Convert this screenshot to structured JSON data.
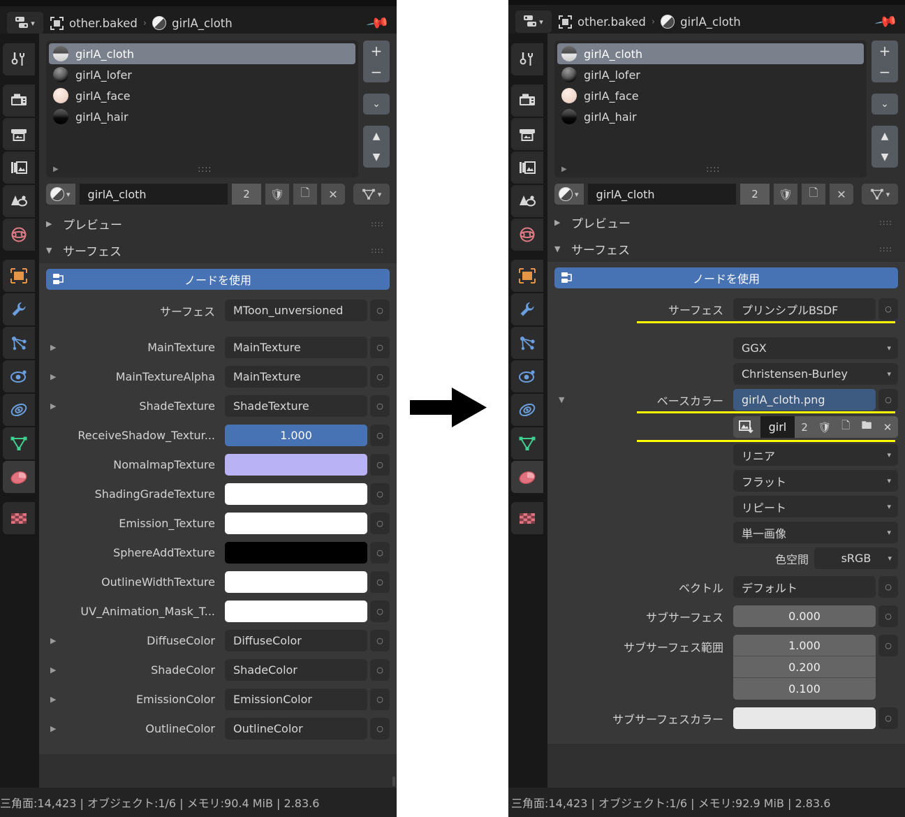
{
  "window": {
    "breadcrumb": {
      "object": "other.baked",
      "separator": "›",
      "material": "girlA_cloth"
    },
    "editor_type_icon": "properties-editor-icon",
    "pin_icon": "pin-icon"
  },
  "tabs": [
    {
      "name": "tool",
      "icon": "tool-icon"
    },
    {
      "name": "render",
      "icon": "camera-back-icon"
    },
    {
      "name": "output",
      "icon": "printer-icon"
    },
    {
      "name": "view-layer",
      "icon": "images-icon"
    },
    {
      "name": "scene",
      "icon": "scene-cone-icon"
    },
    {
      "name": "world",
      "icon": "world-globe-icon"
    },
    {
      "name": "object",
      "icon": "object-square-icon"
    },
    {
      "name": "modifiers",
      "icon": "wrench-icon"
    },
    {
      "name": "particles",
      "icon": "particles-icon"
    },
    {
      "name": "physics",
      "icon": "physics-orbit-icon"
    },
    {
      "name": "constraints",
      "icon": "constraint-icon"
    },
    {
      "name": "object-data",
      "icon": "mesh-data-icon"
    },
    {
      "name": "material",
      "icon": "material-sphere-icon"
    },
    {
      "name": "texture",
      "icon": "checker-texture-icon"
    }
  ],
  "material_slots": {
    "items": [
      {
        "label": "girlA_cloth",
        "thumb": "th-cloth",
        "selected": true
      },
      {
        "label": "girlA_lofer",
        "thumb": "th-lofer",
        "selected": false
      },
      {
        "label": "girlA_face",
        "thumb": "th-face",
        "selected": false
      },
      {
        "label": "girlA_hair",
        "thumb": "th-hair",
        "selected": false
      }
    ],
    "buttons": {
      "add": "+",
      "remove": "−",
      "menu": "⌄",
      "move_up": "▲",
      "move_down": "▼"
    }
  },
  "material_id": {
    "browse_icon": "material-browse-icon",
    "name": "girlA_cloth",
    "users": "2",
    "fake_user_icon": "shield-icon",
    "copy_icon": "copy-icon",
    "unlink_icon": "x-icon",
    "slot_link_icon": "mesh-data-icon"
  },
  "panels": {
    "preview": {
      "label": "プレビュー",
      "open": false
    },
    "surface": {
      "label": "サーフェス",
      "open": true
    }
  },
  "use_nodes_label": "ノードを使用",
  "left_panel": {
    "status": "三角面:14,423 | オブジェクト:1/6 | メモリ:90.4 MiB | 2.83.6",
    "rows": [
      {
        "expand": false,
        "label": "サーフェス",
        "value": "MToon_unversioned",
        "kind": "text",
        "gap": true
      },
      {
        "expand": true,
        "label": "MainTexture",
        "value": "MainTexture",
        "kind": "text"
      },
      {
        "expand": true,
        "label": "MainTextureAlpha",
        "value": "MainTexture",
        "kind": "text"
      },
      {
        "expand": true,
        "label": "ShadeTexture",
        "value": "ShadeTexture",
        "kind": "text"
      },
      {
        "expand": false,
        "label": "ReceiveShadow_Textur...",
        "value": "1.000",
        "kind": "slider"
      },
      {
        "expand": false,
        "label": "NomalmapTexture",
        "value": "",
        "kind": "swatch",
        "swatch": "sw-lav"
      },
      {
        "expand": false,
        "label": "ShadingGradeTexture",
        "value": "",
        "kind": "swatch",
        "swatch": "sw-white"
      },
      {
        "expand": false,
        "label": "Emission_Texture",
        "value": "",
        "kind": "swatch",
        "swatch": "sw-white"
      },
      {
        "expand": false,
        "label": "SphereAddTexture",
        "value": "",
        "kind": "swatch",
        "swatch": "sw-black"
      },
      {
        "expand": false,
        "label": "OutlineWidthTexture",
        "value": "",
        "kind": "swatch",
        "swatch": "sw-white"
      },
      {
        "expand": false,
        "label": "UV_Animation_Mask_T...",
        "value": "",
        "kind": "swatch",
        "swatch": "sw-white"
      },
      {
        "expand": true,
        "label": "DiffuseColor",
        "value": "DiffuseColor",
        "kind": "text"
      },
      {
        "expand": true,
        "label": "ShadeColor",
        "value": "ShadeColor",
        "kind": "text"
      },
      {
        "expand": true,
        "label": "EmissionColor",
        "value": "EmissionColor",
        "kind": "text"
      },
      {
        "expand": true,
        "label": "OutlineColor",
        "value": "OutlineColor",
        "kind": "text"
      }
    ]
  },
  "right_panel": {
    "status": "三角面:14,423 | オブジェクト:1/6 | メモリ:92.9 MiB | 2.83.6",
    "surface_label": "サーフェス",
    "surface_value": "プリンシプルBSDF",
    "distribution": "GGX",
    "subsurface_method": "Christensen-Burley",
    "base_color_label": "ベースカラー",
    "base_color_value": "girlA_cloth.png",
    "texture_block": {
      "browse_icon": "image-browse-icon",
      "name": "girl",
      "users": "2",
      "fake_user_icon": "shield-icon",
      "copy_icon": "copy-icon",
      "open_icon": "folder-icon",
      "unlink_icon": "x-icon"
    },
    "interpolation": "リニア",
    "projection": "フラット",
    "extension": "リピート",
    "source": "単一画像",
    "colorspace_label": "色空間",
    "colorspace_value": "sRGB",
    "vector_label": "ベクトル",
    "vector_value": "デフォルト",
    "subsurface_label": "サブサーフェス",
    "subsurface_value": "0.000",
    "subsurface_radius_label": "サブサーフェス範囲",
    "subsurface_radius": [
      "1.000",
      "0.200",
      "0.100"
    ],
    "subsurface_color_label": "サブサーフェスカラー",
    "highlight_color": "#ffff00"
  },
  "arrow": {
    "name": "right-arrow",
    "color": "#000000"
  }
}
